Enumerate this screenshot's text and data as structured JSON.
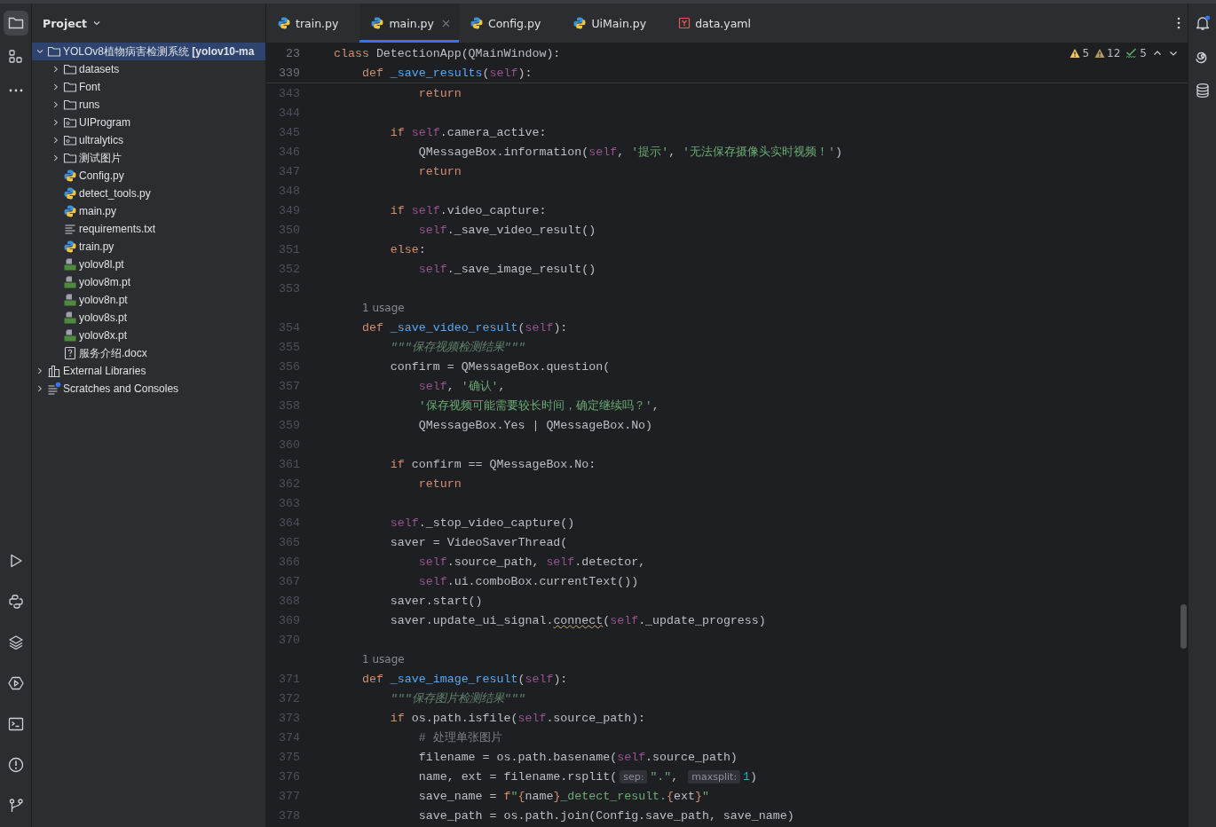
{
  "left_toolbar": {
    "top": [
      {
        "kind": "folder",
        "selected": true
      },
      {
        "kind": "structure",
        "selected": false
      },
      {
        "kind": "more",
        "selected": false
      }
    ],
    "bottom": [
      {
        "kind": "run",
        "selected": false
      },
      {
        "kind": "python",
        "selected": false
      },
      {
        "kind": "layers",
        "selected": false
      },
      {
        "kind": "services",
        "selected": false
      },
      {
        "kind": "terminal",
        "selected": false
      },
      {
        "kind": "problems",
        "selected": false
      },
      {
        "kind": "git",
        "selected": false
      }
    ]
  },
  "project": {
    "title": "Project",
    "tree": [
      {
        "kind": "folder",
        "label": "YOLOv8植物病害检测系统 **[yolov10-ma**",
        "expanded": true,
        "selected": true,
        "children": [
          {
            "kind": "folder",
            "label": "datasets",
            "expanded": false,
            "selected": false
          },
          {
            "kind": "folder",
            "label": "Font",
            "expanded": false,
            "selected": false
          },
          {
            "kind": "folder",
            "label": "runs",
            "expanded": false,
            "selected": false
          },
          {
            "kind": "module",
            "label": "UIProgram",
            "expanded": false,
            "selected": false
          },
          {
            "kind": "module",
            "label": "ultralytics",
            "expanded": false,
            "selected": false
          },
          {
            "kind": "folder",
            "label": "测试图片",
            "expanded": false,
            "selected": false
          },
          {
            "kind": "python",
            "label": "Config.py",
            "selected": false
          },
          {
            "kind": "python",
            "label": "detect_tools.py",
            "selected": false
          },
          {
            "kind": "python",
            "label": "main.py",
            "selected": false
          },
          {
            "kind": "text",
            "label": "requirements.txt",
            "selected": false
          },
          {
            "kind": "python",
            "label": "train.py",
            "selected": false
          },
          {
            "kind": "model",
            "label": "yolov8l.pt",
            "selected": false
          },
          {
            "kind": "model",
            "label": "yolov8m.pt",
            "selected": false
          },
          {
            "kind": "model",
            "label": "yolov8n.pt",
            "selected": false
          },
          {
            "kind": "model",
            "label": "yolov8s.pt",
            "selected": false
          },
          {
            "kind": "model",
            "label": "yolov8x.pt",
            "selected": false
          },
          {
            "kind": "unknown",
            "label": "服务介绍.docx",
            "selected": false
          }
        ]
      },
      {
        "kind": "library",
        "label": "External Libraries",
        "expanded": false,
        "selected": false
      },
      {
        "kind": "scratch",
        "label": "Scratches and Consoles",
        "expanded": false,
        "selected": false
      }
    ]
  },
  "tabs": [
    {
      "kind": "python",
      "label": "train.py",
      "selected": false
    },
    {
      "kind": "python",
      "label": "main.py",
      "selected": true
    },
    {
      "kind": "python",
      "label": "Config.py",
      "selected": false
    },
    {
      "kind": "python",
      "label": "UiMain.py",
      "selected": false
    },
    {
      "kind": "yaml",
      "label": "data.yaml",
      "selected": false
    }
  ],
  "inspections": [
    {
      "kind": "warning",
      "count": "5"
    },
    {
      "kind": "weak",
      "count": "12"
    },
    {
      "kind": "typo",
      "count": "5"
    }
  ],
  "sticky_lines": [
    {
      "number": "23",
      "tokens": [
        {
          "kind": "kw",
          "text": "class"
        },
        {
          "kind": "plain",
          "text": " DetectionApp(QMainWindow):"
        }
      ]
    },
    {
      "number": "339",
      "tokens": [
        {
          "kind": "kw",
          "text": "    def "
        },
        {
          "kind": "fn",
          "text": "_save_results"
        },
        {
          "kind": "plain",
          "text": "("
        },
        {
          "kind": "self",
          "text": "self"
        },
        {
          "kind": "plain",
          "text": "):"
        }
      ]
    }
  ],
  "lines": [
    {
      "kind": "code",
      "number": "343",
      "tokens": [
        {
          "kind": "kw",
          "text": "            return"
        }
      ]
    },
    {
      "kind": "code",
      "number": "344"
    },
    {
      "kind": "code",
      "number": "345",
      "tokens": [
        {
          "kind": "kw",
          "text": "        if "
        },
        {
          "kind": "self",
          "text": "self"
        },
        {
          "kind": "plain",
          "text": ".camera_active:"
        }
      ]
    },
    {
      "kind": "code",
      "number": "346",
      "tokens": [
        {
          "kind": "plain",
          "text": "            QMessageBox.information("
        },
        {
          "kind": "self",
          "text": "self"
        },
        {
          "kind": "plain",
          "text": ", "
        },
        {
          "kind": "str",
          "text": "'提示'"
        },
        {
          "kind": "plain",
          "text": ", "
        },
        {
          "kind": "str",
          "text": "'无法保存摄像头实时视频！'"
        },
        {
          "kind": "plain",
          "text": ")"
        }
      ]
    },
    {
      "kind": "code",
      "number": "347",
      "tokens": [
        {
          "kind": "kw",
          "text": "            return"
        }
      ]
    },
    {
      "kind": "code",
      "number": "348"
    },
    {
      "kind": "code",
      "number": "349",
      "tokens": [
        {
          "kind": "kw",
          "text": "        if "
        },
        {
          "kind": "self",
          "text": "self"
        },
        {
          "kind": "plain",
          "text": ".video_capture:"
        }
      ]
    },
    {
      "kind": "code",
      "number": "350",
      "tokens": [
        {
          "kind": "self",
          "text": "            self"
        },
        {
          "kind": "plain",
          "text": "._save_video_result()"
        }
      ]
    },
    {
      "kind": "code",
      "number": "351",
      "tokens": [
        {
          "kind": "kw",
          "text": "        else"
        },
        {
          "kind": "plain",
          "text": ":"
        }
      ]
    },
    {
      "kind": "code",
      "number": "352",
      "tokens": [
        {
          "kind": "self",
          "text": "            self"
        },
        {
          "kind": "plain",
          "text": "._save_image_result()"
        }
      ]
    },
    {
      "kind": "code",
      "number": "353"
    },
    {
      "kind": "usage",
      "text": "1 usage"
    },
    {
      "kind": "code",
      "number": "354",
      "tokens": [
        {
          "kind": "kw",
          "text": "    def "
        },
        {
          "kind": "fn",
          "text": "_save_video_result"
        },
        {
          "kind": "plain",
          "text": "("
        },
        {
          "kind": "self",
          "text": "self"
        },
        {
          "kind": "plain",
          "text": "):"
        }
      ]
    },
    {
      "kind": "code",
      "number": "355",
      "tokens": [
        {
          "kind": "doc",
          "text": "        \"\"\"保存视频检测结果\"\"\""
        }
      ]
    },
    {
      "kind": "code",
      "number": "356",
      "tokens": [
        {
          "kind": "plain",
          "text": "        confirm = QMessageBox.question("
        }
      ]
    },
    {
      "kind": "code",
      "number": "357",
      "tokens": [
        {
          "kind": "self",
          "text": "            self"
        },
        {
          "kind": "plain",
          "text": ", "
        },
        {
          "kind": "str",
          "text": "'确认'"
        },
        {
          "kind": "plain",
          "text": ","
        }
      ]
    },
    {
      "kind": "code",
      "number": "358",
      "tokens": [
        {
          "kind": "str",
          "text": "            '保存视频可能需要较长时间，确定继续吗？'"
        },
        {
          "kind": "plain",
          "text": ","
        }
      ]
    },
    {
      "kind": "code",
      "number": "359",
      "tokens": [
        {
          "kind": "plain",
          "text": "            QMessageBox.Yes | QMessageBox.No)"
        }
      ]
    },
    {
      "kind": "code",
      "number": "360"
    },
    {
      "kind": "code",
      "number": "361",
      "tokens": [
        {
          "kind": "kw",
          "text": "        if"
        },
        {
          "kind": "plain",
          "text": " confirm == QMessageBox.No:"
        }
      ]
    },
    {
      "kind": "code",
      "number": "362",
      "tokens": [
        {
          "kind": "kw",
          "text": "            return"
        }
      ]
    },
    {
      "kind": "code",
      "number": "363"
    },
    {
      "kind": "code",
      "number": "364",
      "tokens": [
        {
          "kind": "self",
          "text": "        self"
        },
        {
          "kind": "plain",
          "text": "._stop_video_capture()"
        }
      ]
    },
    {
      "kind": "code",
      "number": "365",
      "tokens": [
        {
          "kind": "plain",
          "text": "        saver = VideoSaverThread("
        }
      ]
    },
    {
      "kind": "code",
      "number": "366",
      "tokens": [
        {
          "kind": "self",
          "text": "            self"
        },
        {
          "kind": "plain",
          "text": ".source_path, "
        },
        {
          "kind": "self",
          "text": "self"
        },
        {
          "kind": "plain",
          "text": ".detector,"
        }
      ]
    },
    {
      "kind": "code",
      "number": "367",
      "tokens": [
        {
          "kind": "self",
          "text": "            self"
        },
        {
          "kind": "plain",
          "text": ".ui.comboBox.currentText())"
        }
      ]
    },
    {
      "kind": "code",
      "number": "368",
      "tokens": [
        {
          "kind": "plain",
          "text": "        saver.start()"
        }
      ]
    },
    {
      "kind": "code",
      "number": "369",
      "tokens": [
        {
          "kind": "plain",
          "text": "        saver.update_ui_signal."
        },
        {
          "kind": "warn",
          "text": "connect"
        },
        {
          "kind": "plain",
          "text": "("
        },
        {
          "kind": "self",
          "text": "self"
        },
        {
          "kind": "plain",
          "text": "._update_progress)"
        }
      ]
    },
    {
      "kind": "code",
      "number": "370"
    },
    {
      "kind": "usage",
      "text": "1 usage"
    },
    {
      "kind": "code",
      "number": "371",
      "tokens": [
        {
          "kind": "kw",
          "text": "    def "
        },
        {
          "kind": "fn",
          "text": "_save_image_result"
        },
        {
          "kind": "plain",
          "text": "("
        },
        {
          "kind": "self",
          "text": "self"
        },
        {
          "kind": "plain",
          "text": "):"
        }
      ]
    },
    {
      "kind": "code",
      "number": "372",
      "tokens": [
        {
          "kind": "doc",
          "text": "        \"\"\"保存图片检测结果\"\"\""
        }
      ]
    },
    {
      "kind": "code",
      "number": "373",
      "tokens": [
        {
          "kind": "kw",
          "text": "        if"
        },
        {
          "kind": "plain",
          "text": " os.path.isfile("
        },
        {
          "kind": "self",
          "text": "self"
        },
        {
          "kind": "plain",
          "text": ".source_path):"
        }
      ]
    },
    {
      "kind": "code",
      "number": "374",
      "tokens": [
        {
          "kind": "comment",
          "text": "            # 处理单张图片"
        }
      ]
    },
    {
      "kind": "code",
      "number": "375",
      "tokens": [
        {
          "kind": "plain",
          "text": "            filename = os.path.basename("
        },
        {
          "kind": "self",
          "text": "self"
        },
        {
          "kind": "plain",
          "text": ".source_path)"
        }
      ]
    },
    {
      "kind": "code",
      "number": "376",
      "tokens": [
        {
          "kind": "plain",
          "text": "            name, ext = filename.rsplit("
        },
        {
          "kind": "hint",
          "text": "sep:"
        },
        {
          "kind": "str",
          "text": "\".\""
        },
        {
          "kind": "plain",
          "text": ", "
        },
        {
          "kind": "hint",
          "text": "maxsplit:"
        },
        {
          "kind": "num",
          "text": "1"
        },
        {
          "kind": "plain",
          "text": ")"
        }
      ]
    },
    {
      "kind": "code",
      "number": "377",
      "tokens": [
        {
          "kind": "plain",
          "text": "            save_name = "
        },
        {
          "kind": "kw",
          "text": "f"
        },
        {
          "kind": "str",
          "text": "\""
        },
        {
          "kind": "kw",
          "text": "{"
        },
        {
          "kind": "plain",
          "text": "name"
        },
        {
          "kind": "kw",
          "text": "}"
        },
        {
          "kind": "str",
          "text": "_detect_result."
        },
        {
          "kind": "kw",
          "text": "{"
        },
        {
          "kind": "plain",
          "text": "ext"
        },
        {
          "kind": "kw",
          "text": "}"
        },
        {
          "kind": "str",
          "text": "\""
        }
      ]
    },
    {
      "kind": "code",
      "number": "378",
      "tokens": [
        {
          "kind": "plain",
          "text": "            save_path = os.path.join(Config.save_path, save_name)"
        }
      ]
    }
  ],
  "right_toolbar": [
    {
      "kind": "notifications",
      "selected": false
    },
    {
      "kind": "ai",
      "selected": false
    },
    {
      "kind": "database",
      "selected": false
    }
  ]
}
